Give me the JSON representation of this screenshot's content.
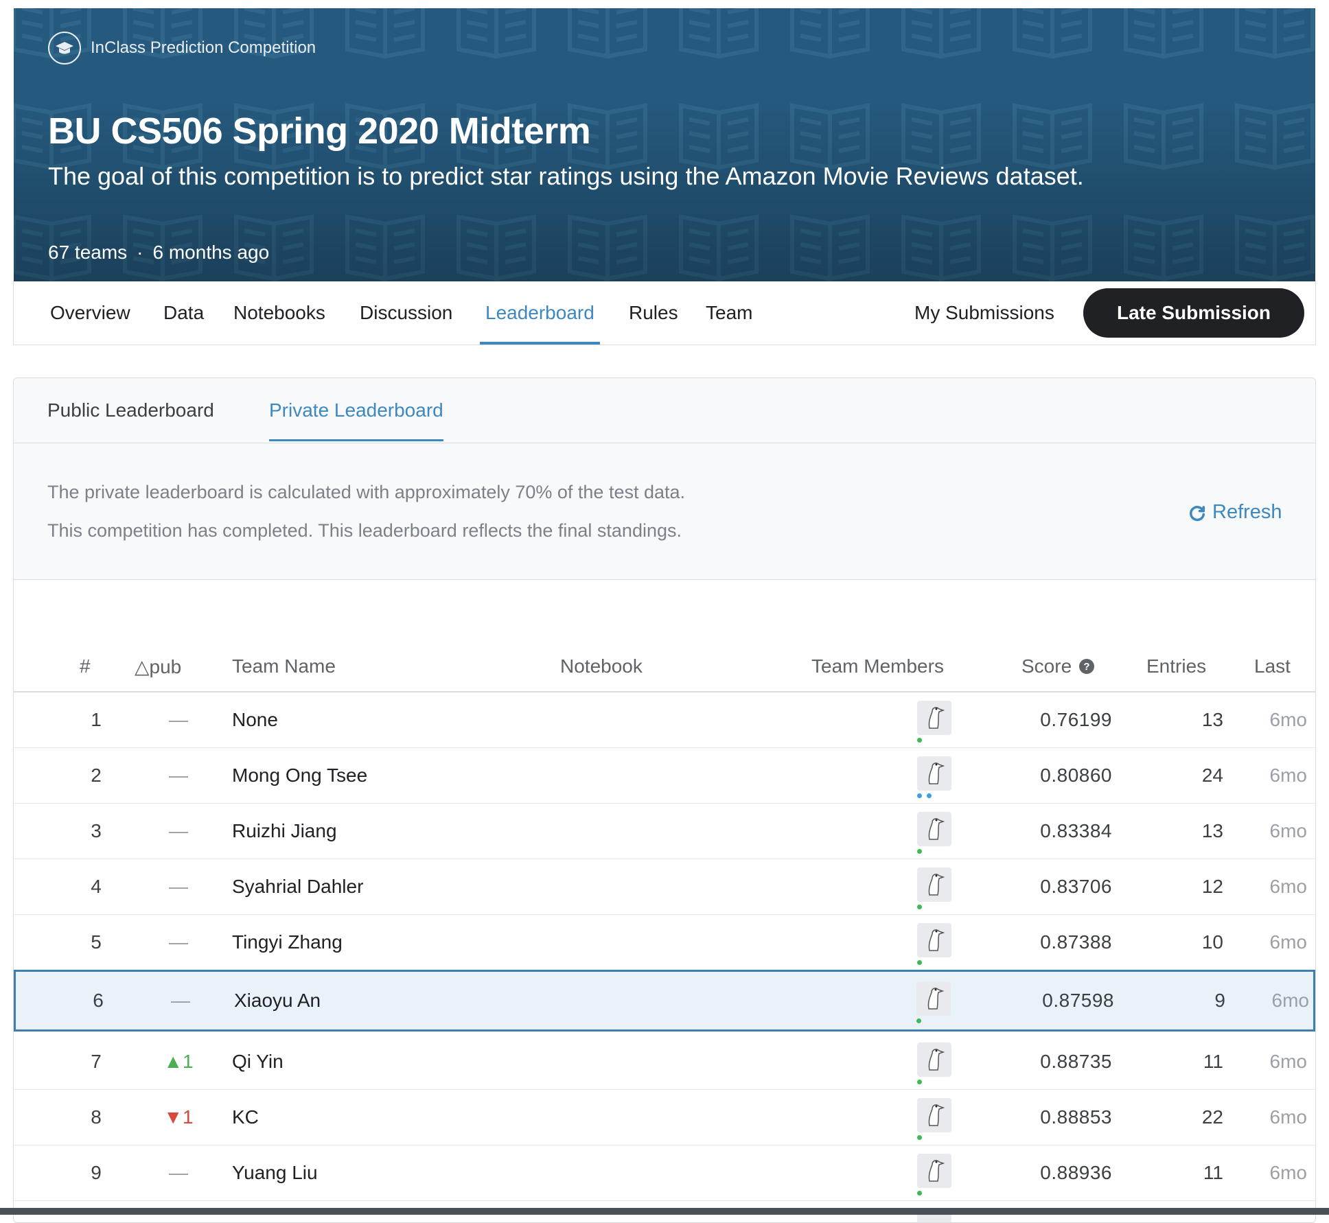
{
  "header": {
    "competition_type": "InClass Prediction Competition",
    "title": "BU CS506 Spring 2020 Midterm",
    "subtitle": "The goal of this competition is to predict star ratings using the Amazon Movie Reviews dataset.",
    "teams": "67 teams",
    "separator": "·",
    "time_ago": "6 months ago"
  },
  "nav": {
    "tabs": [
      "Overview",
      "Data",
      "Notebooks",
      "Discussion",
      "Leaderboard",
      "Rules",
      "Team"
    ],
    "active_tab": "Leaderboard",
    "my_submissions": "My Submissions",
    "late_submission": "Late Submission"
  },
  "leaderboard": {
    "tabs": [
      "Public Leaderboard",
      "Private Leaderboard"
    ],
    "active_tab": "Private Leaderboard",
    "notice_line1": "The private leaderboard is calculated with approximately 70% of the test data.",
    "notice_line2": "This competition has completed. This leaderboard reflects the final standings.",
    "refresh_label": "Refresh",
    "columns": [
      "#",
      "△pub",
      "Team Name",
      "Notebook",
      "Team Members",
      "Score",
      "Entries",
      "Last"
    ],
    "rows": [
      {
        "rank": "1",
        "delta": "—",
        "team": "None",
        "score": "0.76199",
        "entries": "13",
        "last": "6mo"
      },
      {
        "rank": "2",
        "delta": "—",
        "team": "Mong Ong Tsee",
        "score": "0.80860",
        "entries": "24",
        "last": "6mo"
      },
      {
        "rank": "3",
        "delta": "—",
        "team": "Ruizhi Jiang",
        "score": "0.83384",
        "entries": "13",
        "last": "6mo"
      },
      {
        "rank": "4",
        "delta": "—",
        "team": "Syahrial Dahler",
        "score": "0.83706",
        "entries": "12",
        "last": "6mo"
      },
      {
        "rank": "5",
        "delta": "—",
        "team": "Tingyi Zhang",
        "score": "0.87388",
        "entries": "10",
        "last": "6mo"
      },
      {
        "rank": "6",
        "delta": "—",
        "team": "Xiaoyu An",
        "score": "0.87598",
        "entries": "9",
        "last": "6mo"
      },
      {
        "rank": "7",
        "delta": "▲1",
        "team": "Qi Yin",
        "score": "0.88735",
        "entries": "11",
        "last": "6mo"
      },
      {
        "rank": "8",
        "delta": "▼1",
        "team": "KC",
        "score": "0.88853",
        "entries": "22",
        "last": "6mo"
      },
      {
        "rank": "9",
        "delta": "—",
        "team": "Yuang Liu",
        "score": "0.88936",
        "entries": "11",
        "last": "6mo"
      }
    ]
  },
  "colors": {
    "banner": "#25597d",
    "accent": "#3e88c0",
    "highlight_row": "#eaf2f9",
    "up": "#4caf50",
    "down": "#d9483b"
  },
  "icons": [
    "graduation-cap-icon",
    "book-pattern-icon",
    "refresh-icon",
    "help-icon",
    "goose-avatar-icon"
  ]
}
